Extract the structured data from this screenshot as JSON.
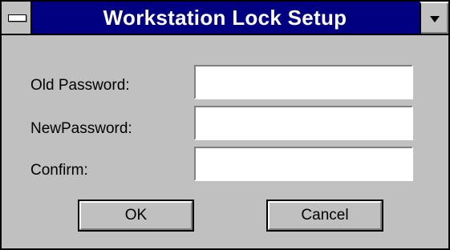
{
  "window": {
    "title": "Workstation Lock Setup",
    "system_menu_icon": "system-menu-icon",
    "dropdown_icon": "dropdown-arrow-icon"
  },
  "form": {
    "old_password": {
      "label": "Old Password:",
      "value": ""
    },
    "new_password": {
      "label": "NewPassword:",
      "value": ""
    },
    "confirm": {
      "label": "Confirm:",
      "value": ""
    }
  },
  "buttons": {
    "ok": "OK",
    "cancel": "Cancel"
  },
  "colors": {
    "titlebar": "#000080",
    "face": "#c0c0c0",
    "field": "#ffffff"
  }
}
